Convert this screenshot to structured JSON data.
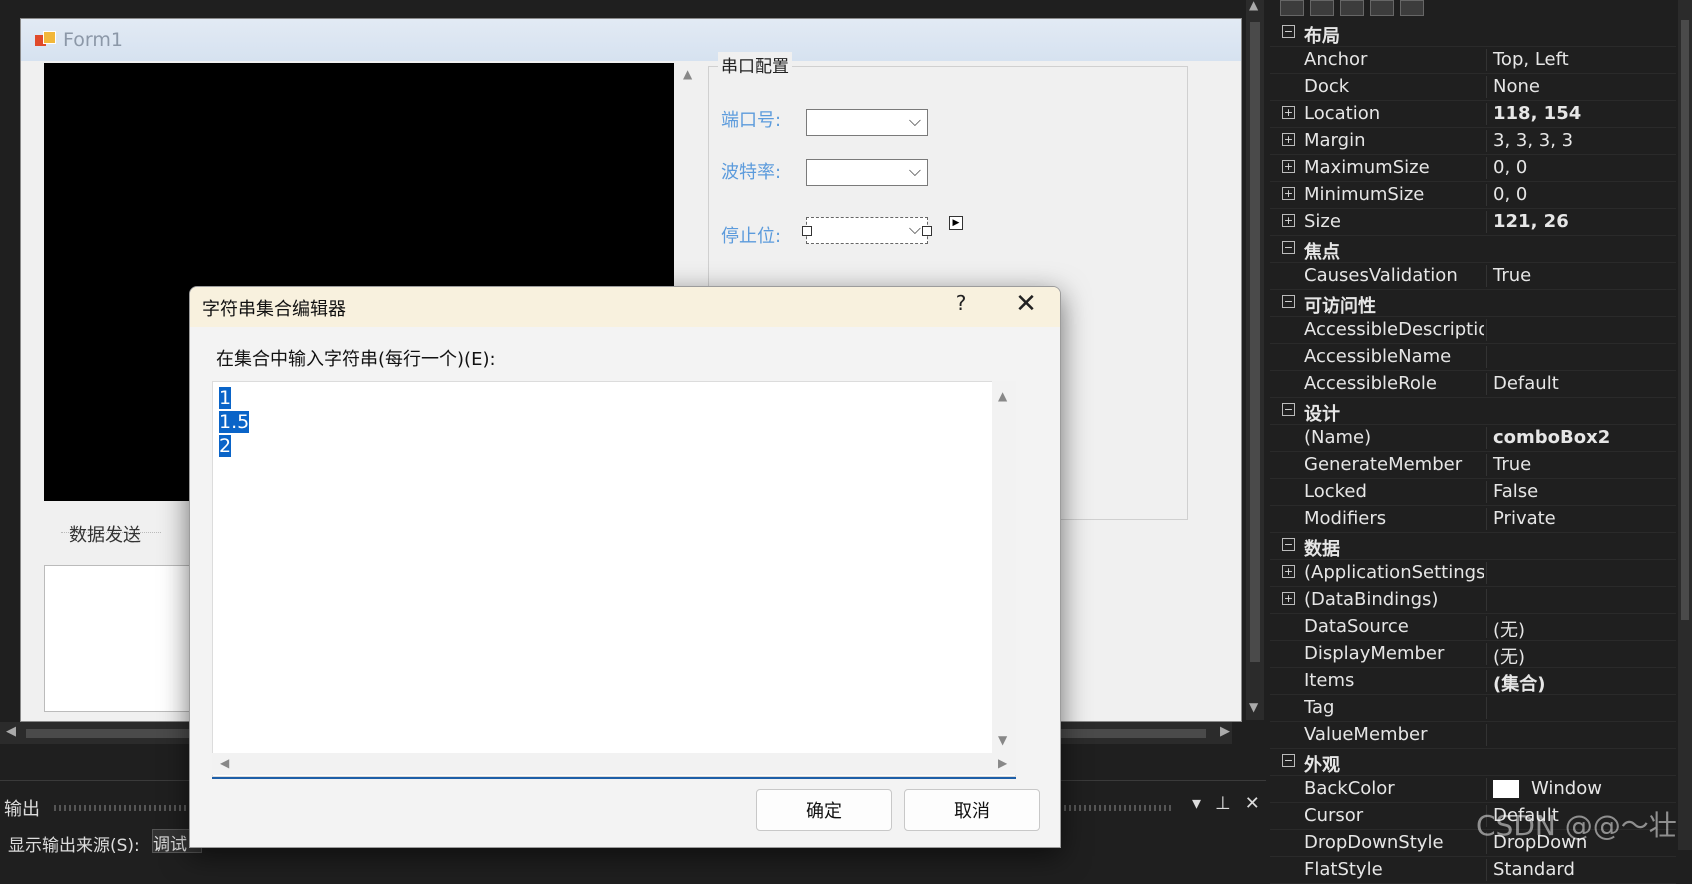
{
  "form1": {
    "title": "Form1",
    "data_send_label": "数据发送",
    "serial_group_title": "串口配置",
    "port_label": "端口号:",
    "baud_label": "波特率:",
    "stop_label": "停止位:"
  },
  "dialog": {
    "title": "字符串集合编辑器",
    "help": "?",
    "close": "✕",
    "prompt": "在集合中输入字符串(每行一个)(E):",
    "lines": [
      "1",
      "1.5",
      "2"
    ],
    "ok": "确定",
    "cancel": "取消"
  },
  "output": {
    "title": "输出",
    "source_label": "显示输出来源(S):",
    "source_value": "调试"
  },
  "props": {
    "rows": [
      {
        "type": "cat",
        "name": "布局",
        "exp": "−"
      },
      {
        "name": "Anchor",
        "value": "Top, Left"
      },
      {
        "name": "Dock",
        "value": "None"
      },
      {
        "name": "Location",
        "value": "118, 154",
        "exp": "+",
        "bold": true
      },
      {
        "name": "Margin",
        "value": "3, 3, 3, 3",
        "exp": "+"
      },
      {
        "name": "MaximumSize",
        "value": "0, 0",
        "exp": "+"
      },
      {
        "name": "MinimumSize",
        "value": "0, 0",
        "exp": "+"
      },
      {
        "name": "Size",
        "value": "121, 26",
        "exp": "+",
        "bold": true
      },
      {
        "type": "cat",
        "name": "焦点",
        "exp": "−"
      },
      {
        "name": "CausesValidation",
        "value": "True"
      },
      {
        "type": "cat",
        "name": "可访问性",
        "exp": "−"
      },
      {
        "name": "AccessibleDescriptio",
        "value": ""
      },
      {
        "name": "AccessibleName",
        "value": ""
      },
      {
        "name": "AccessibleRole",
        "value": "Default"
      },
      {
        "type": "cat",
        "name": "设计",
        "exp": "−"
      },
      {
        "name": "(Name)",
        "value": "comboBox2",
        "bold": true
      },
      {
        "name": "GenerateMember",
        "value": "True"
      },
      {
        "name": "Locked",
        "value": "False"
      },
      {
        "name": "Modifiers",
        "value": "Private"
      },
      {
        "type": "cat",
        "name": "数据",
        "exp": "−"
      },
      {
        "name": "(ApplicationSettings",
        "value": "",
        "exp": "+"
      },
      {
        "name": "(DataBindings)",
        "value": "",
        "exp": "+"
      },
      {
        "name": "DataSource",
        "value": "(无)"
      },
      {
        "name": "DisplayMember",
        "value": "(无)"
      },
      {
        "name": "Items",
        "value": "(集合)",
        "bold": true
      },
      {
        "name": "Tag",
        "value": ""
      },
      {
        "name": "ValueMember",
        "value": ""
      },
      {
        "type": "cat",
        "name": "外观",
        "exp": "−"
      },
      {
        "name": "BackColor",
        "value": "Window",
        "swatch": "#ffffff"
      },
      {
        "name": "Cursor",
        "value": "Default"
      },
      {
        "name": "DropDownStyle",
        "value": "DropDown"
      },
      {
        "name": "FlatStyle",
        "value": "Standard"
      }
    ]
  },
  "watermark": "CSDN @@～壮"
}
